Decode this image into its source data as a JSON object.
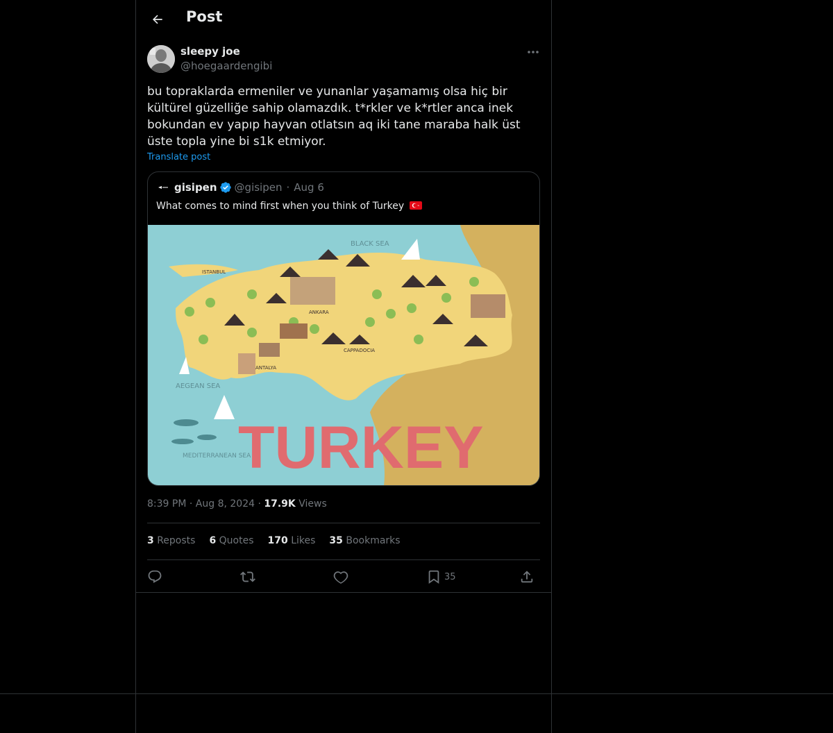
{
  "header": {
    "title": "Post"
  },
  "post": {
    "author_name": "sleepy joe",
    "author_handle": "@hoegaardengibi",
    "text": "bu topraklarda ermeniler ve yunanlar yaşamamış olsa hiç bir kültürel güzelliğe sahip olamazdık. t*rkler ve k*rtler anca inek bokundan ev yapıp hayvan otlatsın aq iki tane maraba halk üst üste topla yine bi s1k etmiyor.",
    "translate_label": "Translate post",
    "time": "8:39 PM",
    "date": "Aug 8, 2024",
    "views_count": "17.9K",
    "views_label": "Views"
  },
  "quote": {
    "name": "gisipen",
    "handle": "@gisipen",
    "date": "Aug 6",
    "text": "What comes to mind first when you think of Turkey",
    "image": {
      "title": "TURKEY",
      "labels": [
        "BLACK SEA",
        "ISTANBUL",
        "ANKARA",
        "CAPPADOCIA",
        "ANTALYA",
        "AEGEAN SEA",
        "MEDITERRANEAN SEA"
      ]
    }
  },
  "stats": {
    "reposts_count": "3",
    "reposts_label": "Reposts",
    "quotes_count": "6",
    "quotes_label": "Quotes",
    "likes_count": "170",
    "likes_label": "Likes",
    "bookmarks_count": "35",
    "bookmarks_label": "Bookmarks"
  },
  "actions": {
    "bookmark_count": "35"
  },
  "colors": {
    "background": "#000000",
    "text": "#e7e9ea",
    "muted": "#71767b",
    "accent": "#1d9bf0",
    "border": "#2f3336"
  }
}
